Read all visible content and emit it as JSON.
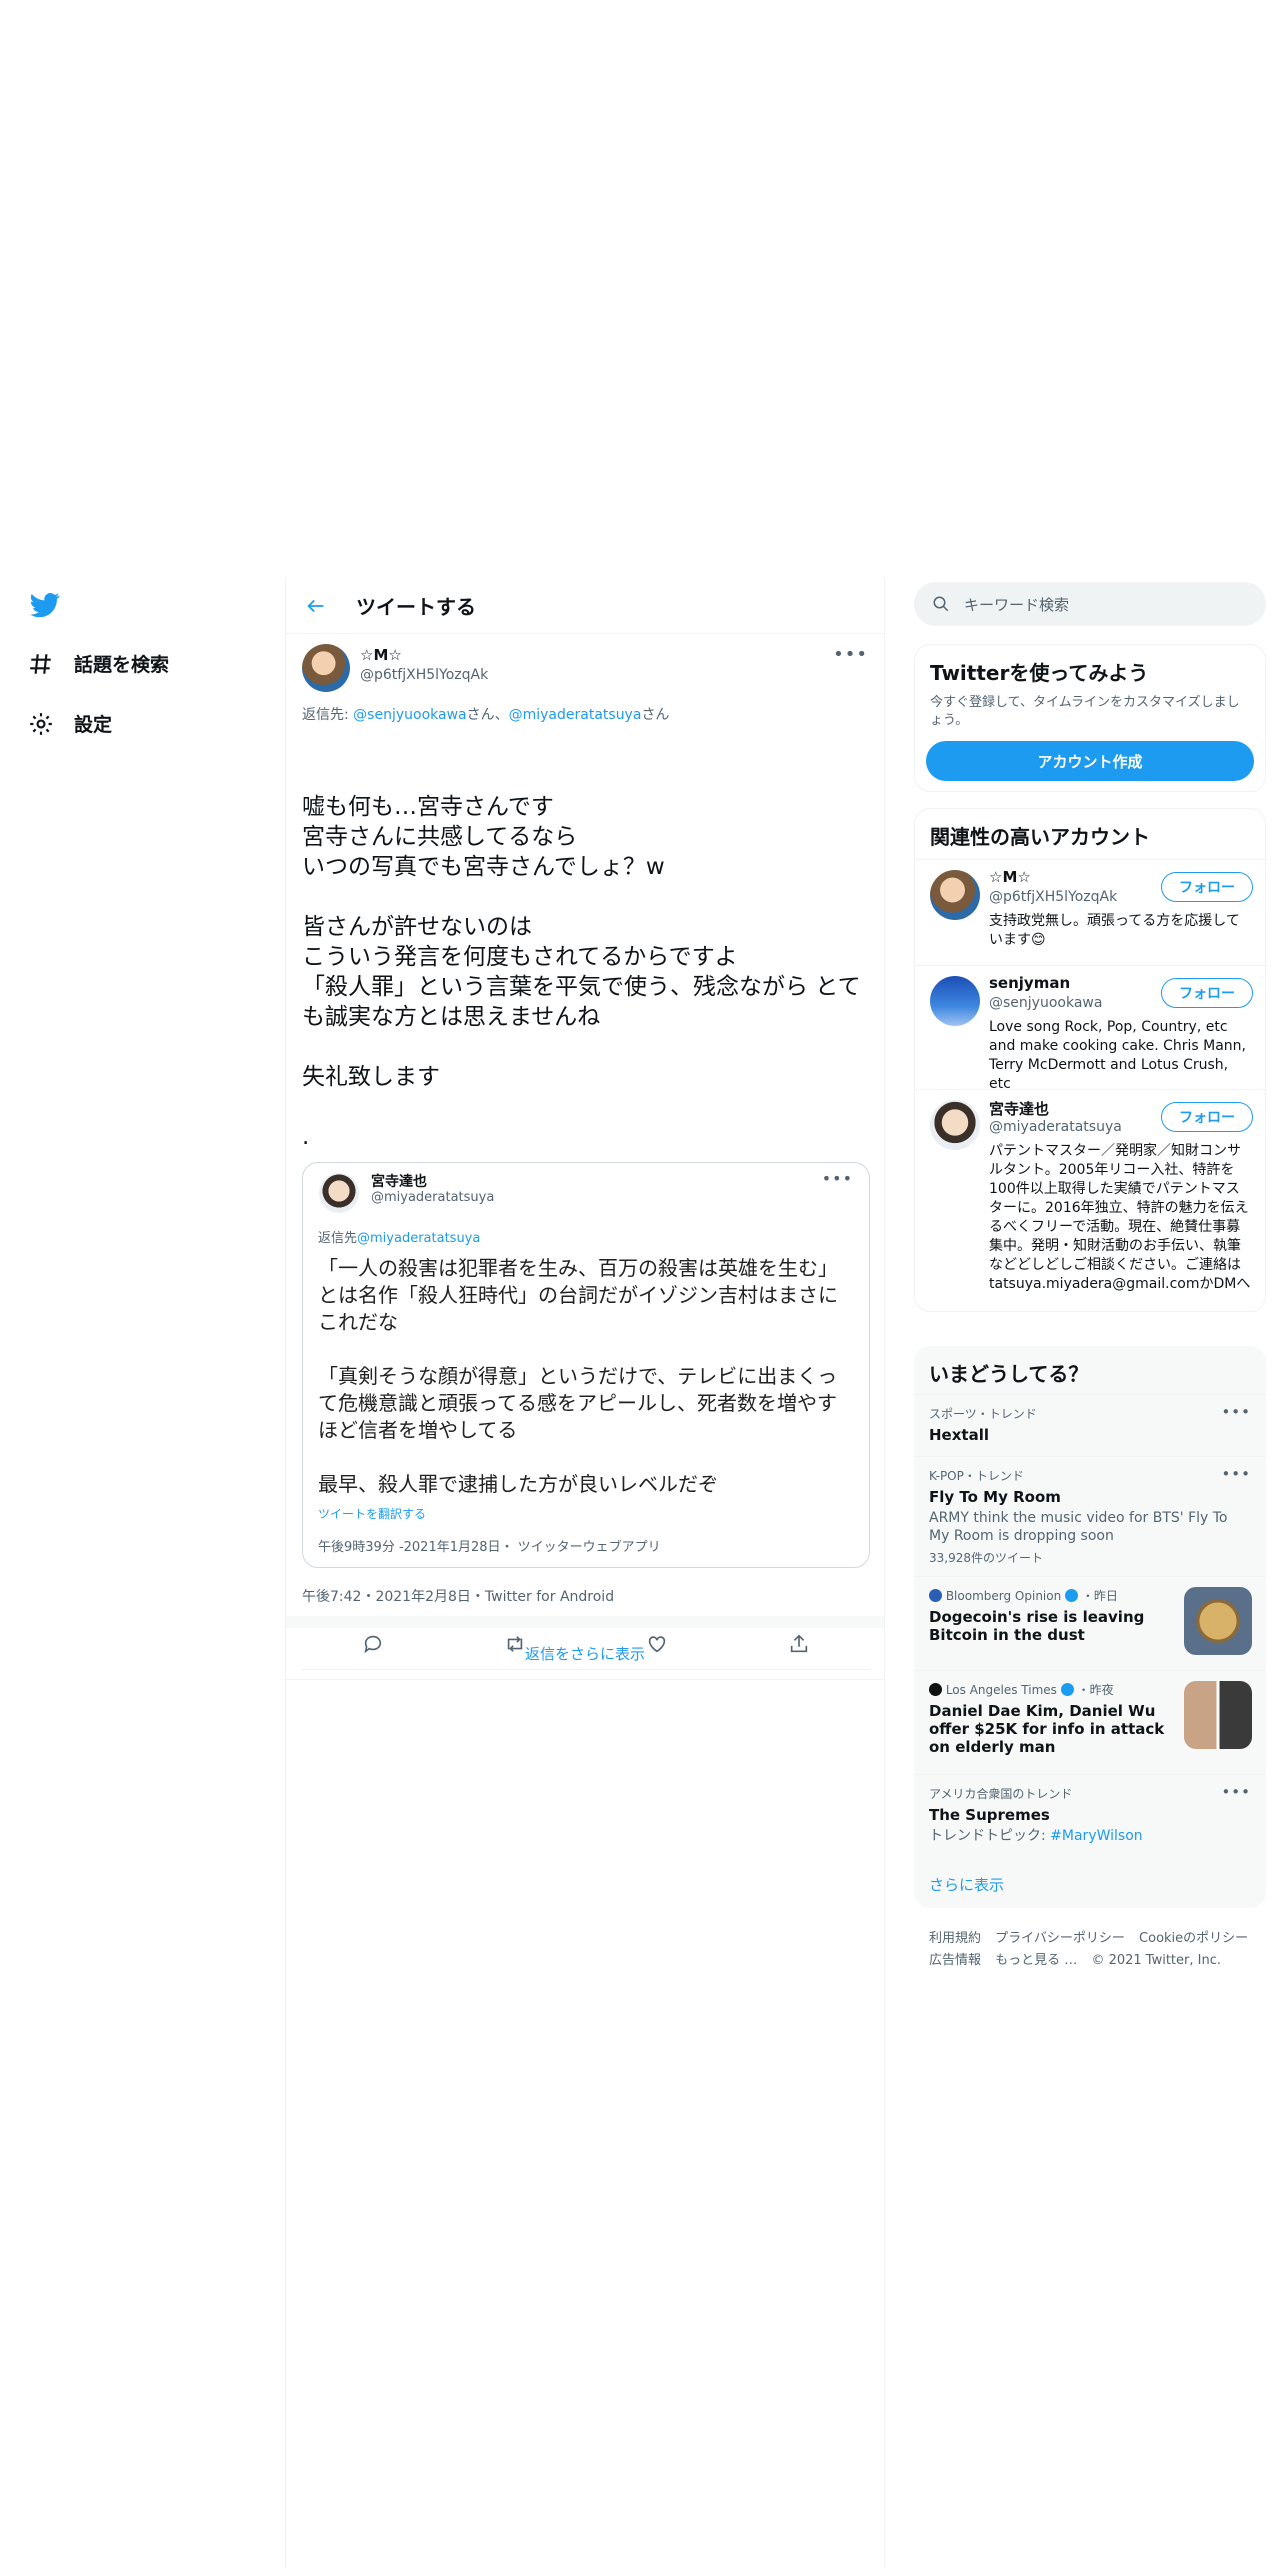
{
  "nav": {
    "items": [
      {
        "label": "話題を検索"
      },
      {
        "label": "設定"
      }
    ]
  },
  "header": {
    "title": "ツイートする"
  },
  "tweet": {
    "name": "☆M☆",
    "handle": "@p6tfjXH5lYozqAk",
    "reply_prefix": "返信先: ",
    "reply_user1": "@senjyuookawa",
    "reply_suffix1": "さん、",
    "reply_user2": "@miyaderatatsuya",
    "reply_suffix2": "さん",
    "text": "嘘も何も…宮寺さんです\n宮寺さんに共感してるなら\nいつの写真でも宮寺さんでしょ？w\n\n皆さんが許せないのは\nこういう発言を何度もされてるからですよ\n「殺人罪」という言葉を平気で使う、残念ながら とても誠実な方とは思えませんね\n\n失礼致します\n\n.",
    "meta": "午後7:42・2021年2月8日・Twitter for Android"
  },
  "quote": {
    "name": "宮寺達也",
    "handle": "@miyaderatatsuya",
    "reply_prefix": "返信先",
    "reply_user": "@miyaderatatsuya",
    "text": "「一人の殺害は犯罪者を生み、百万の殺害は英雄を生む」とは名作「殺人狂時代」の台詞だがイゾジン吉村はまさにこれだな\n\n「真剣そうな顔が得意」というだけで、テレビに出まくって危機意識と頑張ってる感をアピールし、死者数を増やすほど信者を増やしてる\n\n最早、殺人罪で逮捕した方が良いレベルだぞ",
    "translate": "ツイートを翻訳する",
    "meta": "午後9時39分 -2021年1月28日・ ツイッターウェブアプリ"
  },
  "show_more_replies": "返信をさらに表示",
  "search": {
    "placeholder": "キーワード検索"
  },
  "try_twitter": {
    "title": "Twitterを使ってみよう",
    "desc": "今すぐ登録して、タイムラインをカスタマイズしましょう。",
    "button": "アカウント作成"
  },
  "related": {
    "title": "関連性の高いアカウント",
    "follow_label": "フォロー",
    "accounts": [
      {
        "name": "☆M☆",
        "handle": "@p6tfjXH5lYozqAk",
        "bio": "支持政党無し。頑張ってる方を応援しています😊"
      },
      {
        "name": "senjyman",
        "handle": "@senjyuookawa",
        "bio": "Love song Rock, Pop, Country, etc and make cooking cake. Chris Mann, Terry McDermott and Lotus Crush, etc"
      },
      {
        "name": "宮寺達也",
        "handle": "@miyaderatatsuya",
        "bio": "パテントマスター／発明家／知財コンサルタント。2005年リコー入社、特許を100件以上取得した実績でパテントマスターに。2016年独立、特許の魅力を伝えるべくフリーで活動。現在、絶賛仕事募集中。発明・知財活動のお手伝い、執筆などどしどしご相談ください。ご連絡は tatsuya.miyadera@gmail.comかDMへ"
      }
    ]
  },
  "trends": {
    "title": "いまどうしてる？",
    "items": [
      {
        "context": "スポーツ・トレンド",
        "topic": "Hextall"
      },
      {
        "context": "K-POP・トレンド",
        "topic": "Fly To My Room",
        "sub": "ARMY think the music video for BTS' Fly To My Room is dropping soon",
        "count": "33,928件のツイート"
      },
      {
        "source": "Bloomberg Opinion",
        "time": "・昨日",
        "topic": "Dogecoin's rise is leaving Bitcoin in the dust"
      },
      {
        "source": "Los Angeles Times",
        "time": "・昨夜",
        "topic": "Daniel Dae Kim, Daniel Wu offer $25K for info in attack on elderly man"
      },
      {
        "context": "アメリカ合衆国のトレンド",
        "topic": "The Supremes",
        "sub_prefix": "トレンドトピック: ",
        "sub_link": "#MaryWilson"
      }
    ],
    "show_more": "さらに表示"
  },
  "footer": {
    "line1": [
      "利用規約",
      "プライバシーポリシー",
      "Cookieのポリシー"
    ],
    "line2": [
      "広告情報",
      "もっと見る …",
      "© 2021 Twitter, Inc."
    ]
  },
  "colors": {
    "accent": "#1d9bf0",
    "text": "#0f1419",
    "muted": "#536471"
  }
}
